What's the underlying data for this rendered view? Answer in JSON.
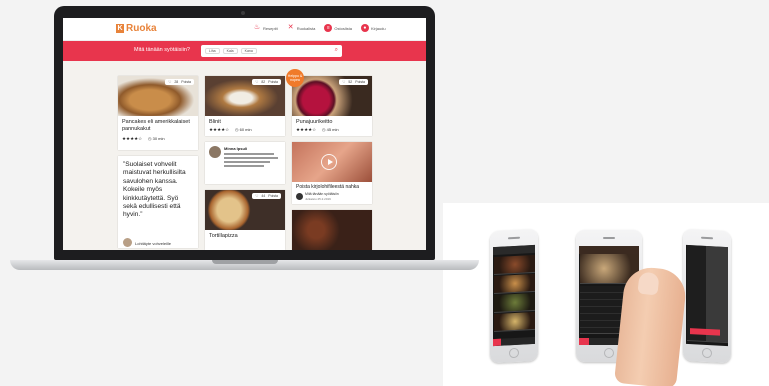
{
  "site": {
    "logo": "Ruoka",
    "logo_mark": "K",
    "nav": [
      {
        "label": "Reseptit",
        "icon": "apron-icon"
      },
      {
        "label": "Ruokalista",
        "icon": "utensils-icon"
      },
      {
        "label": "Ostoslista",
        "icon": "list-icon"
      },
      {
        "label": "Kirjaudu",
        "icon": "user-icon"
      }
    ]
  },
  "search": {
    "question": "Mitä tänään syötäisiin?",
    "chips": [
      "Liha",
      "Kala",
      "Kana"
    ]
  },
  "cards": [
    {
      "title_line1": "Pancakes eli amerikkalaiset",
      "title_line2": "pannukakut",
      "stars": "★★★★☆",
      "time": "30 min",
      "likes": "28",
      "remove": "Poista"
    },
    {
      "title_line1": "Blinit",
      "stars": "★★★★☆",
      "time": "60 min",
      "likes": "82",
      "remove": "Poista"
    },
    {
      "title_line1": "Punajuurikeitto",
      "stars": "★★★★☆",
      "time": "45 min",
      "likes": "52",
      "remove": "Poista",
      "badge": "Helppo & nopea"
    },
    {
      "title_line1": "Tortillapizza",
      "likes": "44",
      "remove": "Poista"
    },
    {
      "title_line1": "Poista kirjolohifileestä nahka",
      "author": "Mitä tänään syötäisiin",
      "date": "Julkaistu 25.2.2019"
    }
  ],
  "quote": {
    "text": "”Suolaiset vohvelit maistuvat herkullisilta savulohen kanssa. Kokeile myös kinkkutäytettä. Syö sekä edullisesti että hyvin.”",
    "author": "Lohitäyte vohveleille"
  },
  "comment": {
    "name": "Minna Ipsuli"
  },
  "colors": {
    "brand_red": "#e8354d",
    "logo_orange": "#e8833a",
    "badge_orange": "#f07a2a"
  }
}
